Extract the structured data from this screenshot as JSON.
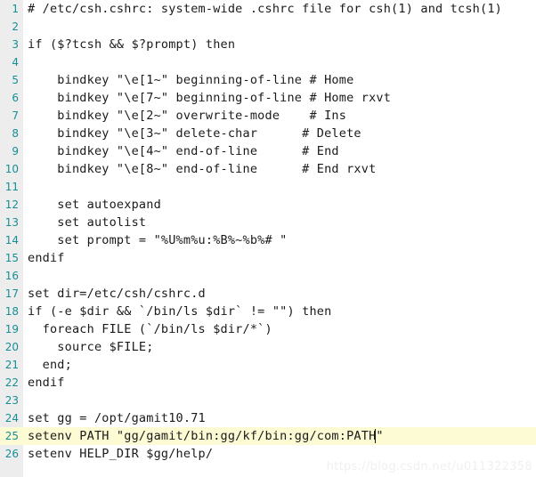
{
  "editor": {
    "file_title": "/etc/csh.cshrc",
    "colors": {
      "background": "#ffffff",
      "gutter_background": "#ededed",
      "line_number": "#168f94",
      "text": "#1a1a1a",
      "highlight_row": "#fdfbd4",
      "caret": "#1a1a1a",
      "watermark": "#f0f0f0"
    },
    "total_lines": 26,
    "highlighted_line": 25,
    "caret_line": 25,
    "caret_column": 48,
    "lines": [
      {
        "number": "1",
        "text": "# /etc/csh.cshrc: system-wide .cshrc file for csh(1) and tcsh(1)"
      },
      {
        "number": "2",
        "text": ""
      },
      {
        "number": "3",
        "text": "if ($?tcsh && $?prompt) then"
      },
      {
        "number": "4",
        "text": ""
      },
      {
        "number": "5",
        "text": "    bindkey \"\\e[1~\" beginning-of-line # Home"
      },
      {
        "number": "6",
        "text": "    bindkey \"\\e[7~\" beginning-of-line # Home rxvt"
      },
      {
        "number": "7",
        "text": "    bindkey \"\\e[2~\" overwrite-mode    # Ins"
      },
      {
        "number": "8",
        "text": "    bindkey \"\\e[3~\" delete-char      # Delete"
      },
      {
        "number": "9",
        "text": "    bindkey \"\\e[4~\" end-of-line      # End"
      },
      {
        "number": "10",
        "text": "    bindkey \"\\e[8~\" end-of-line      # End rxvt"
      },
      {
        "number": "11",
        "text": ""
      },
      {
        "number": "12",
        "text": "    set autoexpand"
      },
      {
        "number": "13",
        "text": "    set autolist"
      },
      {
        "number": "14",
        "text": "    set prompt = \"%U%m%u:%B%~%b%# \""
      },
      {
        "number": "15",
        "text": "endif"
      },
      {
        "number": "16",
        "text": ""
      },
      {
        "number": "17",
        "text": "set dir=/etc/csh/cshrc.d"
      },
      {
        "number": "18",
        "text": "if (-e $dir && `/bin/ls $dir` != \"\") then"
      },
      {
        "number": "19",
        "text": "  foreach FILE (`/bin/ls $dir/*`)"
      },
      {
        "number": "20",
        "text": "    source $FILE;"
      },
      {
        "number": "21",
        "text": "  end;"
      },
      {
        "number": "22",
        "text": "endif"
      },
      {
        "number": "23",
        "text": ""
      },
      {
        "number": "24",
        "text": "set gg = /opt/gamit10.71"
      },
      {
        "number": "25",
        "text": "setenv PATH \"gg/gamit/bin:gg/kf/bin:gg/com:PATH\""
      },
      {
        "number": "26",
        "text": "setenv HELP_DIR $gg/help/"
      }
    ]
  },
  "watermark": {
    "text": "https://blog.csdn.net/u011322358"
  }
}
